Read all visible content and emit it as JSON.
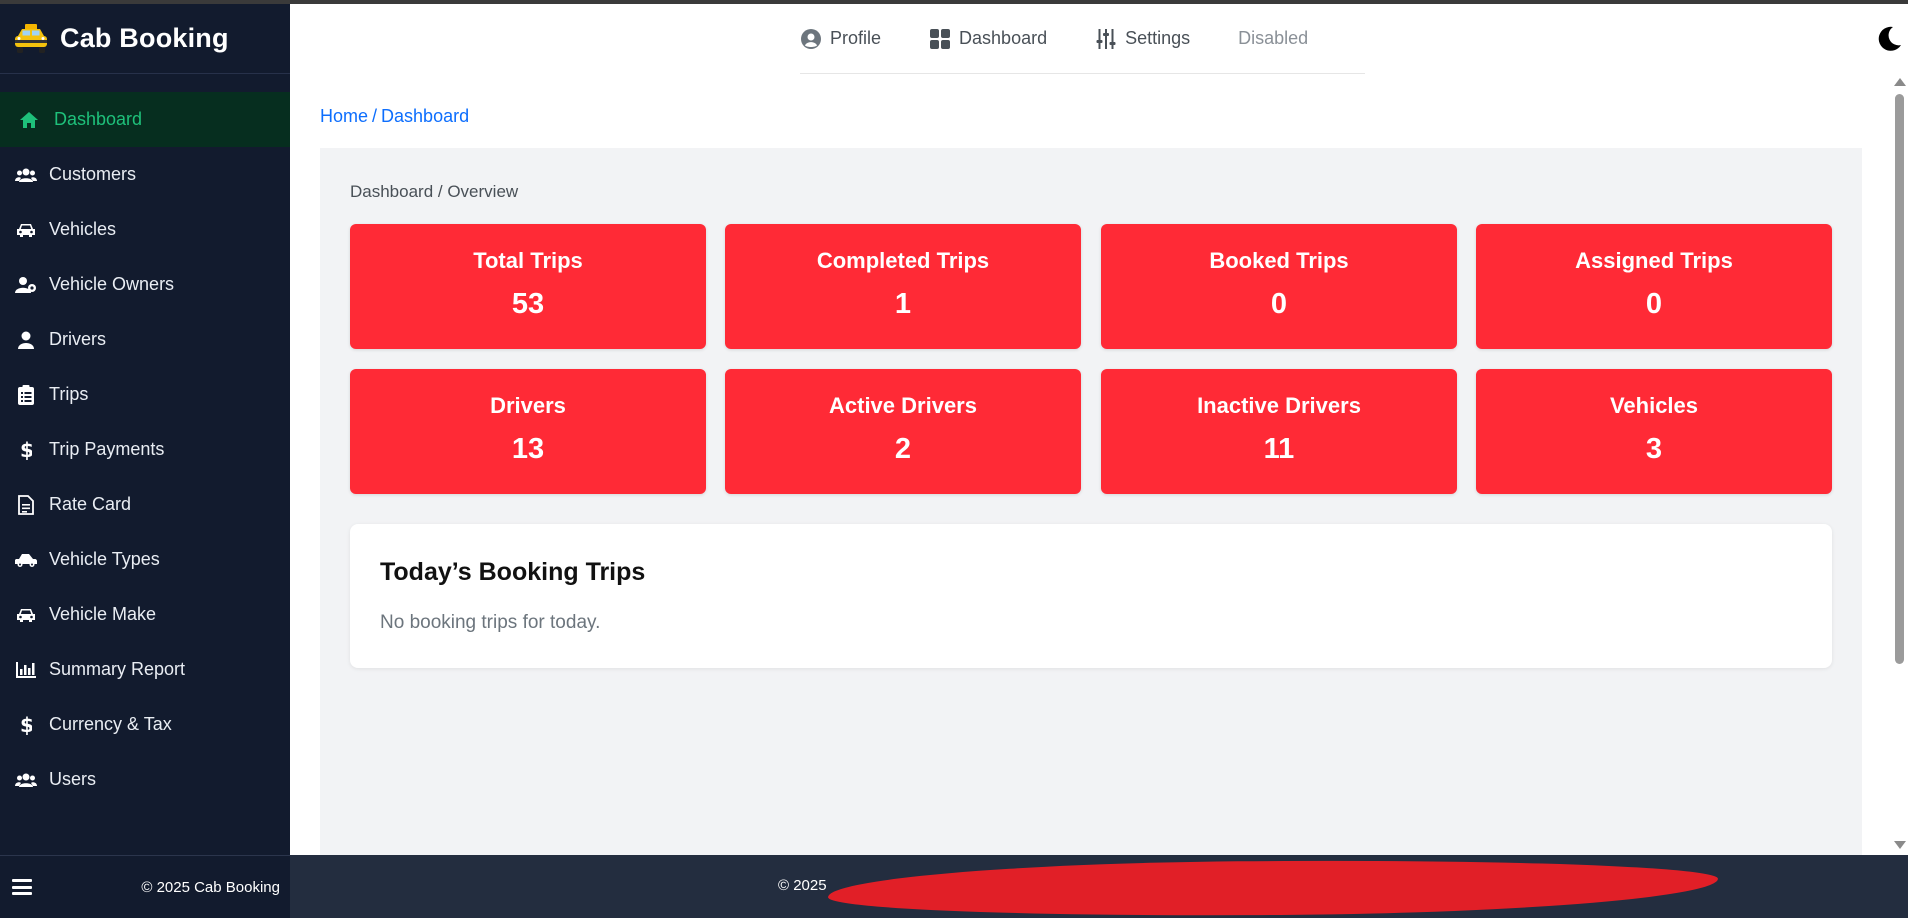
{
  "brand": {
    "name": "Cab Booking"
  },
  "sidebar": {
    "items": [
      {
        "label": "Dashboard",
        "icon": "home-icon",
        "active": true
      },
      {
        "label": "Customers",
        "icon": "users-icon"
      },
      {
        "label": "Vehicles",
        "icon": "car-icon"
      },
      {
        "label": "Vehicle Owners",
        "icon": "user-gear-icon"
      },
      {
        "label": "Drivers",
        "icon": "user-icon"
      },
      {
        "label": "Trips",
        "icon": "clipboard-icon"
      },
      {
        "label": "Trip Payments",
        "icon": "dollar-icon"
      },
      {
        "label": "Rate Card",
        "icon": "document-icon"
      },
      {
        "label": "Vehicle Types",
        "icon": "car-side-icon"
      },
      {
        "label": "Vehicle Make",
        "icon": "car-icon"
      },
      {
        "label": "Summary Report",
        "icon": "bar-chart-icon"
      },
      {
        "label": "Currency & Tax",
        "icon": "dollar-icon"
      },
      {
        "label": "Users",
        "icon": "users-icon"
      }
    ],
    "footer": "© 2025 Cab Booking"
  },
  "topnav": {
    "links": [
      {
        "label": "Profile",
        "icon": "user-circle-icon"
      },
      {
        "label": "Dashboard",
        "icon": "grid-icon"
      },
      {
        "label": "Settings",
        "icon": "sliders-icon"
      },
      {
        "label": "Disabled",
        "disabled": true
      }
    ]
  },
  "breadcrumb": {
    "home": "Home",
    "separator": "/",
    "current": "Dashboard"
  },
  "panel": {
    "title": "Dashboard / Overview"
  },
  "stats": [
    {
      "label": "Total Trips",
      "value": "53"
    },
    {
      "label": "Completed Trips",
      "value": "1"
    },
    {
      "label": "Booked Trips",
      "value": "0"
    },
    {
      "label": "Assigned Trips",
      "value": "0"
    },
    {
      "label": "Drivers",
      "value": "13"
    },
    {
      "label": "Active Drivers",
      "value": "2"
    },
    {
      "label": "Inactive Drivers",
      "value": "11"
    },
    {
      "label": "Vehicles",
      "value": "3"
    }
  ],
  "booking": {
    "title": "Today’s Booking Trips",
    "empty": "No booking trips for today."
  },
  "footer": {
    "copyright": "© 2025"
  },
  "colors": {
    "sidebar_bg": "#121b2e",
    "active_green": "#1ec07a",
    "card_red": "#ff2a36",
    "link_blue": "#0d6efd",
    "footer_bg": "#232d3f"
  }
}
